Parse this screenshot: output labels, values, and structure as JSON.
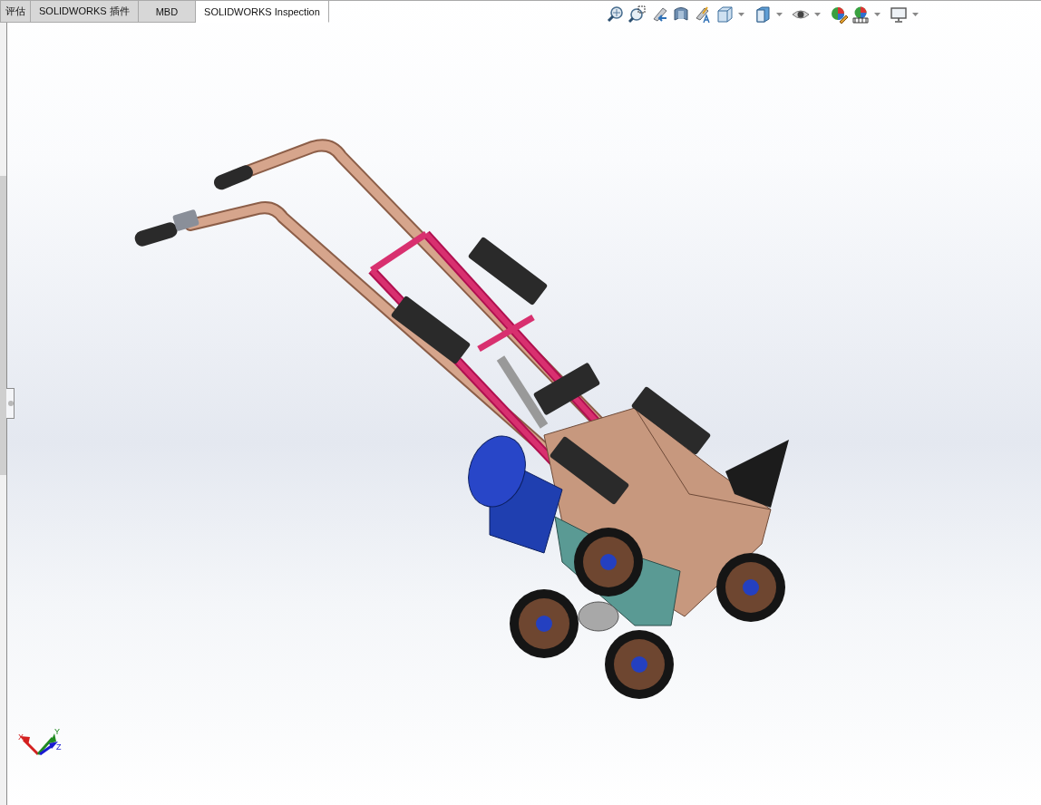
{
  "tabs": [
    {
      "label": "评估",
      "selected": false
    },
    {
      "label": "SOLIDWORKS 插件",
      "selected": false
    },
    {
      "label": "MBD",
      "selected": false
    },
    {
      "label": "SOLIDWORKS Inspection",
      "selected": true
    }
  ],
  "view_toolbar": [
    {
      "kind": "zoom-fit",
      "dropdown": false
    },
    {
      "kind": "zoom-area",
      "dropdown": false
    },
    {
      "kind": "previous-view",
      "dropdown": false
    },
    {
      "kind": "section",
      "dropdown": false
    },
    {
      "kind": "annotation",
      "dropdown": false
    },
    {
      "kind": "orientation",
      "dropdown": true
    },
    {
      "kind": "display-style",
      "dropdown": true
    },
    {
      "kind": "hide-show",
      "dropdown": true
    },
    {
      "kind": "appearance",
      "dropdown": false
    },
    {
      "kind": "scene",
      "dropdown": true
    },
    {
      "kind": "settings",
      "dropdown": true
    }
  ],
  "triad": {
    "axes": [
      {
        "label": "X",
        "color": "#d42020"
      },
      {
        "label": "Y",
        "color": "#1f8a1f"
      },
      {
        "label": "Z",
        "color": "#1a1ad0"
      }
    ]
  }
}
